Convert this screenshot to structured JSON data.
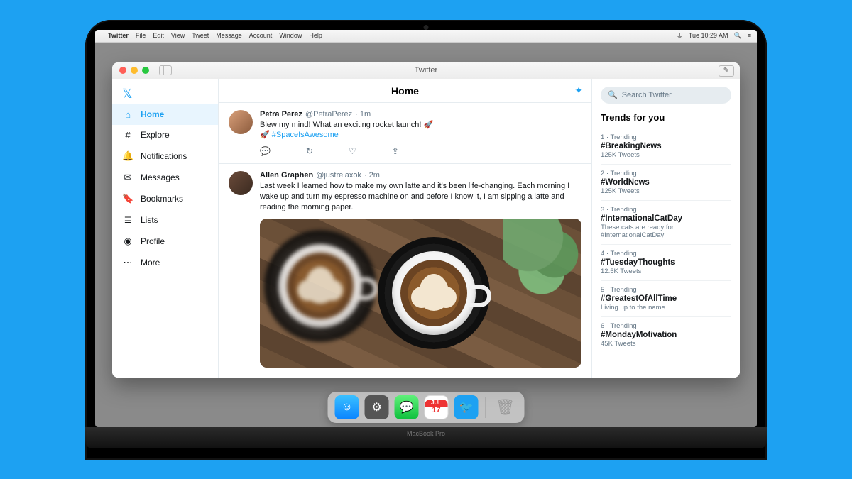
{
  "menubar": {
    "app": "Twitter",
    "items": [
      "File",
      "Edit",
      "View",
      "Tweet",
      "Message",
      "Account",
      "Window",
      "Help"
    ],
    "clock": "Tue 10:29 AM"
  },
  "window": {
    "title": "Twitter"
  },
  "sidebar": {
    "items": [
      {
        "icon": "⌂",
        "label": "Home",
        "active": true
      },
      {
        "icon": "#",
        "label": "Explore"
      },
      {
        "icon": "🔔",
        "label": "Notifications"
      },
      {
        "icon": "✉",
        "label": "Messages"
      },
      {
        "icon": "🔖",
        "label": "Bookmarks"
      },
      {
        "icon": "≣",
        "label": "Lists"
      },
      {
        "icon": "◉",
        "label": "Profile"
      },
      {
        "icon": "⋯",
        "label": "More"
      }
    ]
  },
  "feed": {
    "title": "Home",
    "tweets": [
      {
        "name": "Petra Perez",
        "handle": "@PetraPerez",
        "time": "1m",
        "text_pre": "Blew my mind! What an exciting rocket launch! 🚀",
        "text_post": "🚀 ",
        "hashtag": "#SpaceIsAwesome"
      },
      {
        "name": "Allen Graphen",
        "handle": "@justrelaxok",
        "time": "2m",
        "text": "Last week I learned how to make my own latte and it's been life-changing. Each morning I wake up and turn my espresso machine on and before I know it, I am sipping a latte and reading the morning paper."
      }
    ]
  },
  "rail": {
    "search_placeholder": "Search Twitter",
    "trends_title": "Trends for you",
    "trends": [
      {
        "meta": "1 · Trending",
        "tag": "#BreakingNews",
        "count": "125K Tweets"
      },
      {
        "meta": "2 · Trending",
        "tag": "#WorldNews",
        "count": "125K Tweets"
      },
      {
        "meta": "3 · Trending",
        "tag": "#InternationalCatDay",
        "count": "These cats are ready for #InternationalCatDay"
      },
      {
        "meta": "4 · Trending",
        "tag": "#TuesdayThoughts",
        "count": "12.5K Tweets"
      },
      {
        "meta": "5 · Trending",
        "tag": "#GreatestOfAllTime",
        "count": "Living up to the name"
      },
      {
        "meta": "6 · Trending",
        "tag": "#MondayMotivation",
        "count": "45K Tweets"
      }
    ]
  },
  "dock": {
    "cal_month": "JUL",
    "cal_day": "17"
  },
  "hinge": "MacBook Pro"
}
